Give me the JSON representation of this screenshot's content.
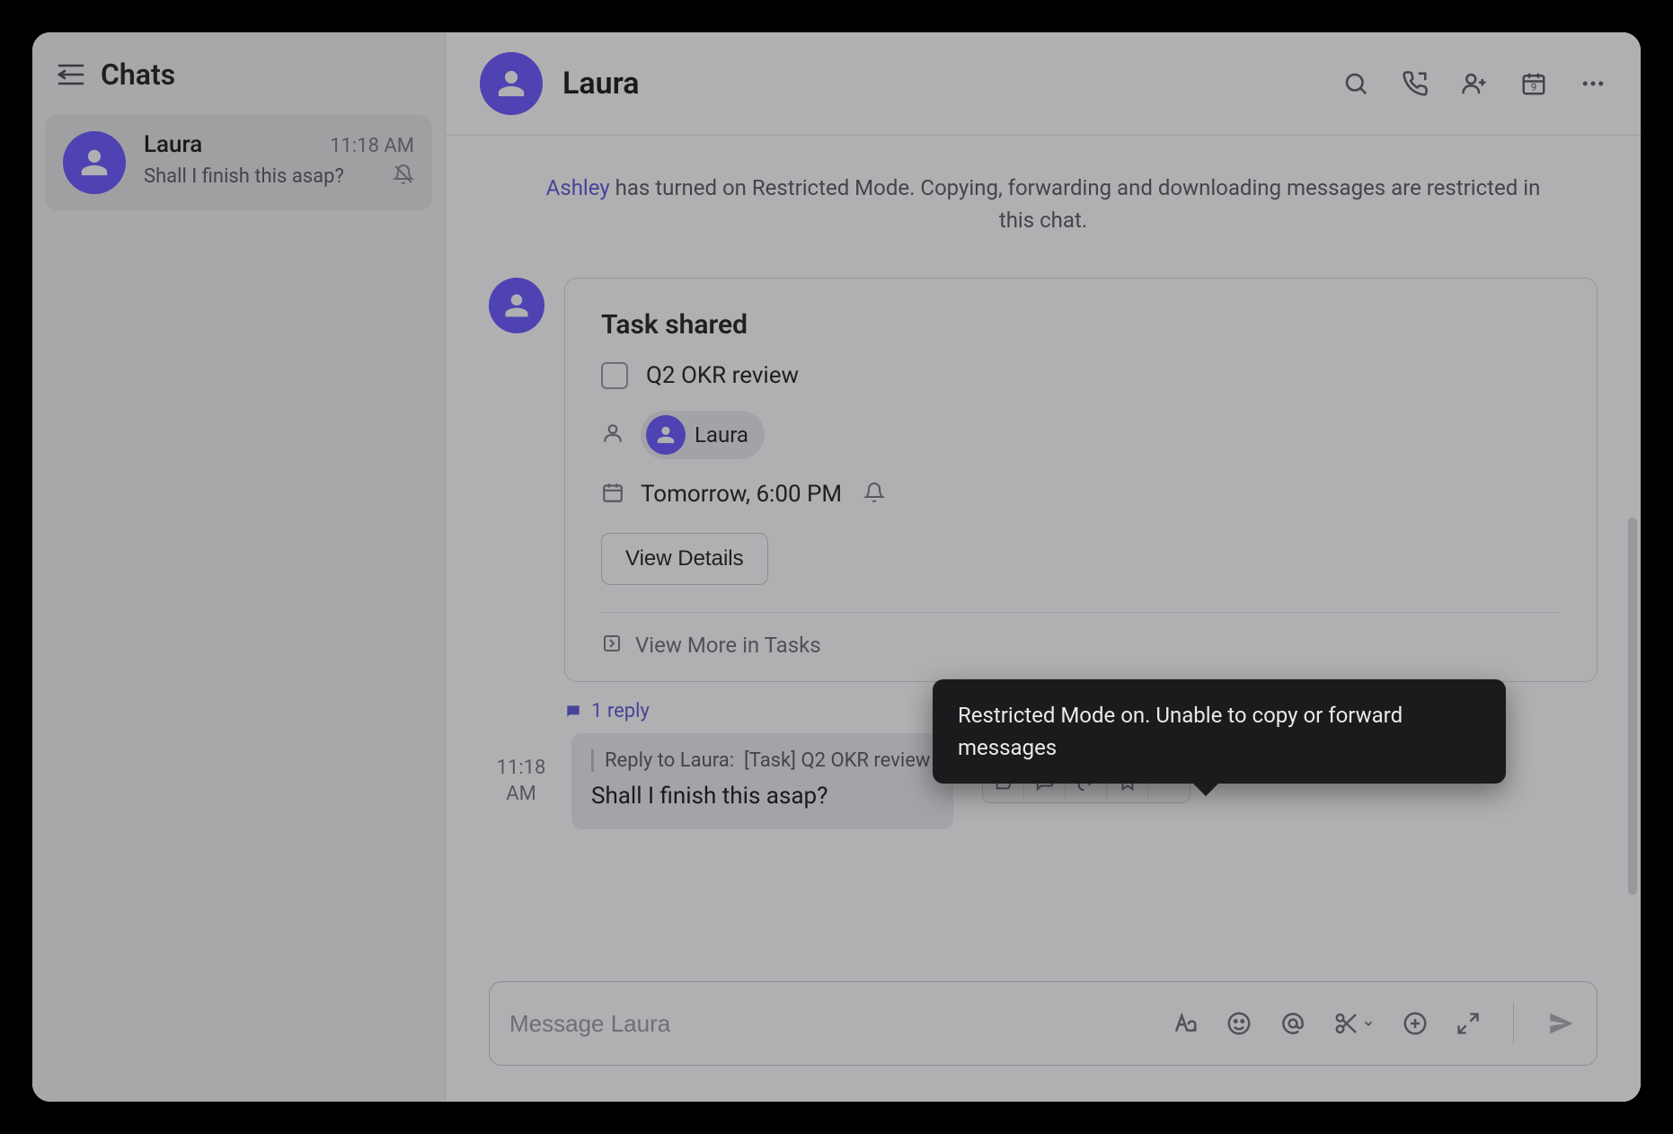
{
  "sidebar": {
    "title": "Chats",
    "items": [
      {
        "name": "Laura",
        "time": "11:18 AM",
        "preview": "Shall I finish this asap?",
        "muted": true
      }
    ]
  },
  "chat": {
    "title": "Laura",
    "system_message": {
      "actor": "Ashley",
      "text_rest": " has turned on Restricted Mode. Copying, forwarding and downloading messages are restricted in this chat."
    },
    "task_card": {
      "header": "Task shared",
      "task_name": "Q2 OKR review",
      "assignee": "Laura",
      "due": "Tomorrow, 6:00 PM",
      "view_details_label": "View Details",
      "view_more_label": "View More in Tasks"
    },
    "reply_count_label": "1 reply",
    "reply": {
      "time_line1": "11:18",
      "time_line2": "AM",
      "quote_prefix": "Reply to Laura:",
      "quote_tag": "[Task]",
      "quote_title": "Q2 OKR review",
      "text": "Shall I finish this asap?"
    }
  },
  "composer": {
    "placeholder": "Message Laura"
  },
  "tooltip": {
    "text": "Restricted Mode on. Unable to copy or forward messages"
  }
}
